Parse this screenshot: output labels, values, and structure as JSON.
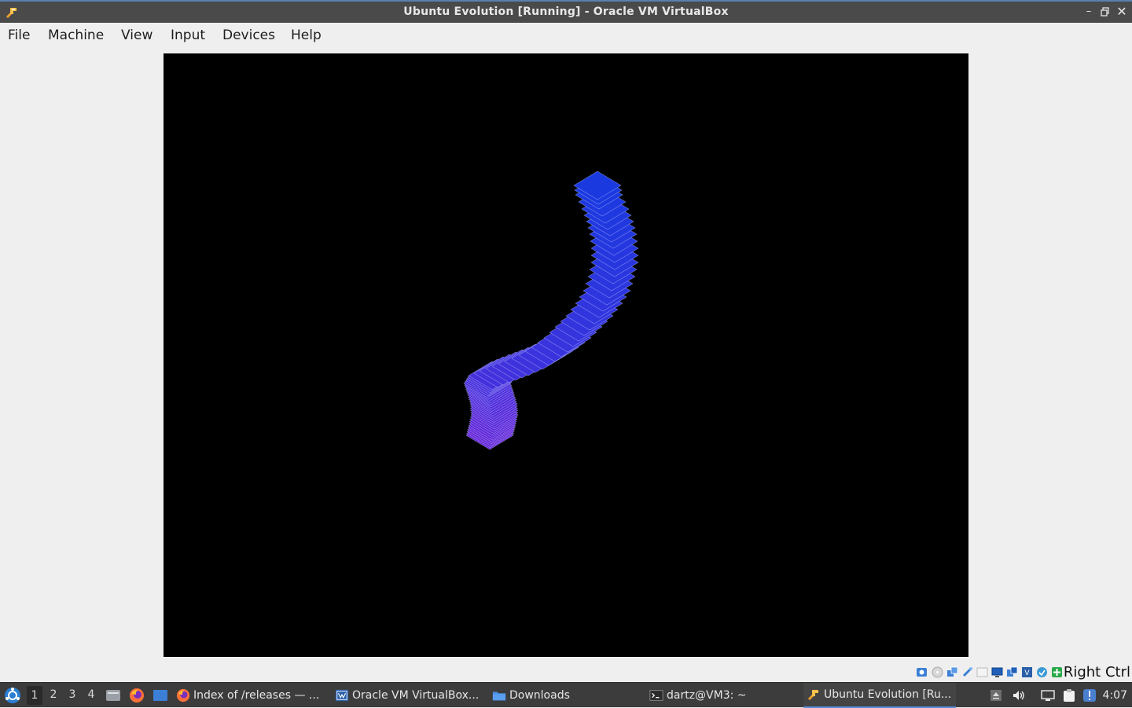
{
  "window": {
    "title": "Ubuntu Evolution [Running] - Oracle VM VirtualBox",
    "controls": [
      "minimize-icon",
      "restore-icon",
      "close-icon"
    ]
  },
  "menu": {
    "items": [
      "File",
      "Machine",
      "View",
      "Input",
      "Devices",
      "Help"
    ]
  },
  "vm_display": {
    "background": "#000000",
    "shape_color_top": "#1a3ae0",
    "shape_color_bottom": "#6a28d8",
    "outline_color": "#c0c8ff"
  },
  "vm_status": {
    "icons": [
      "hard-disk-icon",
      "optical-drive-icon",
      "network-icon",
      "usb-icon",
      "shared-folders-icon",
      "display-icon",
      "video-capture-icon",
      "virtualization-icon",
      "mouse-integration-icon",
      "recording-icon"
    ],
    "host_key": "Right Ctrl"
  },
  "taskbar": {
    "workspaces": [
      "1",
      "2",
      "3",
      "4"
    ],
    "active_workspace": "1",
    "launchers": [
      "file-manager-icon",
      "firefox-icon",
      "desktop-icon"
    ],
    "tasks": [
      {
        "label": "Index of /releases — ...",
        "icon": "firefox-icon"
      },
      {
        "label": "Oracle VM VirtualBox...",
        "icon": "virtualbox-manager-icon"
      },
      {
        "label": "Downloads",
        "icon": "folder-icon"
      },
      {
        "label": "dartz@VM3: ~",
        "icon": "terminal-icon"
      },
      {
        "label": "Ubuntu Evolution [Ru...",
        "icon": "virtualbox-vm-icon"
      }
    ],
    "tray_icons": [
      "eject-icon",
      "volume-icon",
      "network-tray-icon",
      "clipboard-icon",
      "notification-icon"
    ],
    "clock": "4:07"
  }
}
